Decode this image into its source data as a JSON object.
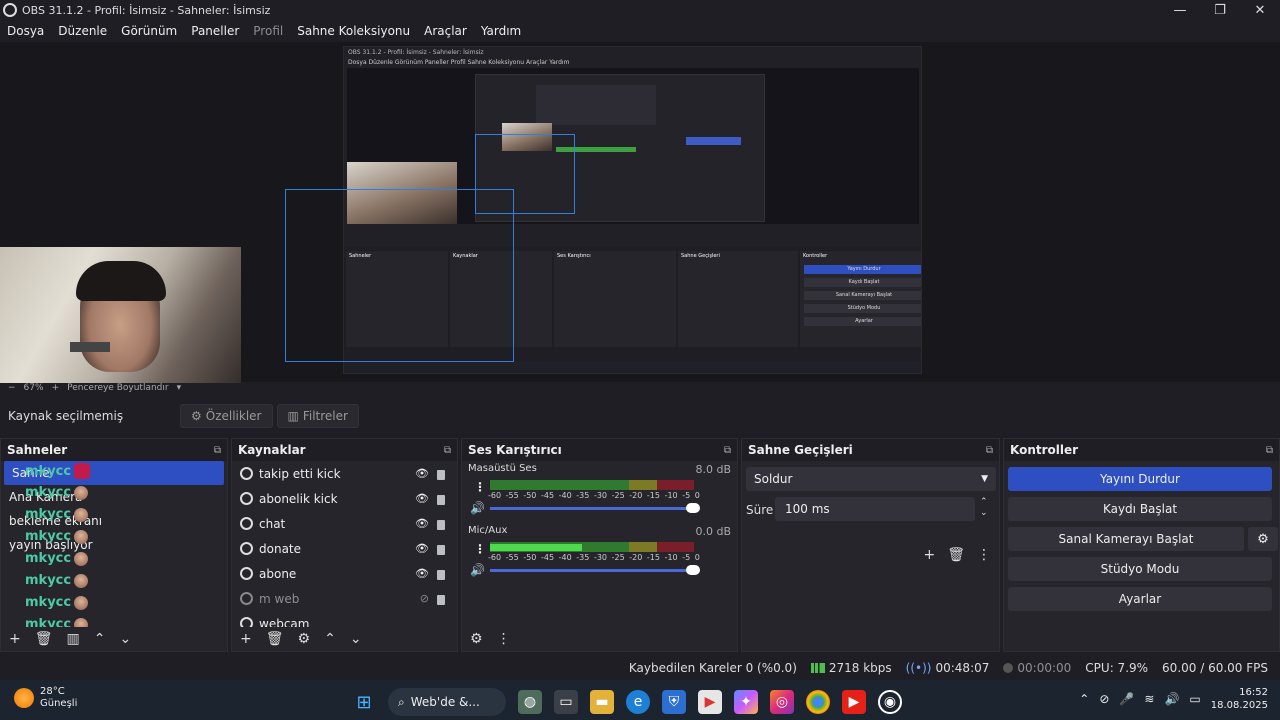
{
  "window": {
    "title": "OBS 31.1.2 - Profil: İsimsiz - Sahneler: İsimsiz",
    "controls": [
      "—",
      "❐",
      "✕"
    ]
  },
  "menu": [
    "Dosya",
    "Düzenle",
    "Görünüm",
    "Paneller",
    "Profil",
    "Sahne Koleksiyonu",
    "Araçlar",
    "Yardım"
  ],
  "preview": {
    "zoom": "67%",
    "fit_label": "Pencereye Boyutlandır",
    "nested_title": "OBS 31.1.2 - Profil: İsimsiz - Sahneler: İsimsiz",
    "nested_menu": "Dosya   Düzenle   Görünüm   Paneller   Profil   Sahne Koleksiyonu   Araçlar   Yardım",
    "nested_panels": [
      "Sahneler",
      "Kaynaklar",
      "Ses Karıştırıcı",
      "Sahne Geçişleri",
      "Kontroller"
    ],
    "nested_controls": [
      "Yayını Durdur",
      "Kaydı Başlat",
      "Sanal Kamerayı Başlat",
      "Stüdyo Modu",
      "Ayarlar"
    ]
  },
  "source_toolbar": {
    "no_source": "Kaynak seçilmemiş",
    "properties": "Özellikler",
    "filters": "Filtreler"
  },
  "scenes": {
    "title": "Sahneler",
    "items": [
      "Sahne",
      "Ana Kamera",
      "bekleme ekranı",
      "yayın başlıyor"
    ],
    "chat_name": "mkycc"
  },
  "sources": {
    "title": "Kaynaklar",
    "items": [
      {
        "label": "takip etti kick",
        "visible": true
      },
      {
        "label": "abonelik kick",
        "visible": true
      },
      {
        "label": "chat",
        "visible": true
      },
      {
        "label": "donate",
        "visible": true
      },
      {
        "label": "abone",
        "visible": true
      },
      {
        "label": "m web",
        "visible": false
      },
      {
        "label": "webcam",
        "visible": true
      }
    ]
  },
  "mixer": {
    "title": "Ses Karıştırıcı",
    "ticks": [
      "-60",
      "-55",
      "-50",
      "-45",
      "-40",
      "-35",
      "-30",
      "-25",
      "-20",
      "-15",
      "-10",
      "-5",
      "0"
    ],
    "channels": [
      {
        "name": "Masaüstü Ses",
        "db": "8.0 dB",
        "level": 0.0
      },
      {
        "name": "Mic/Aux",
        "db": "0.0 dB",
        "level": 0.45
      }
    ]
  },
  "transitions": {
    "title": "Sahne Geçişleri",
    "selected": "Soldur",
    "duration_label": "Süre",
    "duration_value": "100 ms"
  },
  "controls": {
    "title": "Kontroller",
    "stop_stream": "Yayını Durdur",
    "start_record": "Kaydı Başlat",
    "start_virtualcam": "Sanal Kamerayı Başlat",
    "studio_mode": "Stüdyo Modu",
    "settings": "Ayarlar"
  },
  "status": {
    "dropped": "Kaybedilen Kareler 0 (%0.0)",
    "bitrate": "2718 kbps",
    "stream_time": "00:48:07",
    "record_time": "00:00:00",
    "cpu": "CPU: 7.9%",
    "fps": "60.00 / 60.00 FPS"
  },
  "taskbar": {
    "weather_temp": "28°C",
    "weather_desc": "Güneşli",
    "search": "Web'de &...",
    "time": "16:52",
    "date": "18.08.2025"
  },
  "colors": {
    "accent": "#2d4fc2",
    "panel": "#26252b",
    "background": "#1f1e24"
  }
}
